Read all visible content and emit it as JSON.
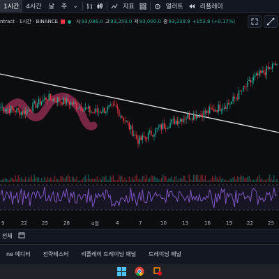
{
  "toolbar": {
    "interval_active": "1시간",
    "interval_other": "4시간",
    "day": "날",
    "week": "주",
    "indicators": "지표",
    "alerts": "얼러트",
    "replay": "리플레이"
  },
  "legend": {
    "symbol": "ntract · 1시간 · BINANCE",
    "open_label": "시",
    "open": "93,086.0",
    "high_label": "고",
    "high": "93,250.0",
    "low_label": "저",
    "low": "93,000.0",
    "close_label": "종",
    "close": "93,239.9",
    "change": "+153.8 (+0.17%)"
  },
  "xaxis": {
    "labels": [
      "9",
      "22",
      "25",
      "28",
      "4월",
      "4",
      "7",
      "10",
      "13",
      "16",
      "19",
      "22",
      "25"
    ]
  },
  "bottom_bar": {
    "label": "전체"
  },
  "panel_tabs": [
    "ne 에디터",
    "전략테스터",
    "리플레이 트레이딩 패널",
    "트레이딩 패널"
  ],
  "colors": {
    "up": "#22ab94",
    "down": "#f23645",
    "rsi": "#7e57c2",
    "trendline": "#e6e6e6",
    "highlight": "#c2185b"
  },
  "icons": [
    "bar-chart-icon",
    "candle-icon",
    "indicators-icon",
    "alert-icon",
    "replay-icon",
    "fullscreen-icon",
    "line-tool-icon",
    "calendar-range-icon"
  ],
  "chart_data": {
    "type": "candlestick",
    "x": [
      "9",
      "22",
      "25",
      "28",
      "4월",
      "4",
      "7",
      "10",
      "13",
      "16",
      "19",
      "22",
      "25"
    ],
    "close": [
      96000,
      95500,
      97000,
      96500,
      95500,
      96000,
      92500,
      94000,
      95000,
      95500,
      96500,
      99000,
      100500
    ],
    "last_close": 93239.9,
    "indicators": [
      "volume",
      "RSI"
    ],
    "drawings": [
      "trendline",
      "highlighter"
    ],
    "grid": false
  }
}
